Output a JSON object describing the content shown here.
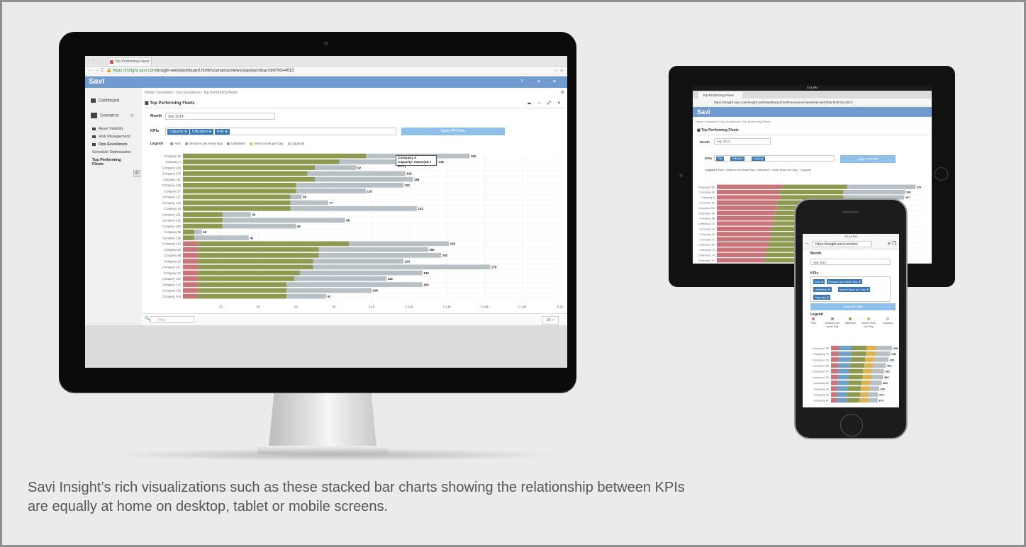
{
  "caption": "Savi Insight’s rich visualizations such as these stacked bar charts showing the relationship between KPIs are equally at home on desktop, tablet or mobile screens.",
  "desktop": {
    "browser": {
      "tab_title": "Top Performing Fleets",
      "url_https": "https://insight.savi.com",
      "url_rest": "/insight-web/dashboard.html#scenarios/views/stacked-hbar.html?id=4013"
    },
    "app": {
      "logo": "Savi",
      "header_icons": "? ⇥ ≡"
    },
    "sidebar": {
      "items": [
        {
          "label": "Dashboard",
          "icon": "dashboard-icon"
        },
        {
          "label": "Scenarios",
          "icon": "bar-chart-icon"
        },
        {
          "label": "Asset Visibility"
        },
        {
          "label": "Risk Management"
        },
        {
          "label": "Ops Excellence"
        },
        {
          "label": "Schedule Optimization"
        },
        {
          "label": "Top Performing Fleets"
        }
      ]
    },
    "breadcrumb": "Home /  Scenarios /  Ops Excellence /  Top Performing Fleets",
    "panel": {
      "title": "Top Performing Fleets",
      "tools": "☁ − ⤢ ×",
      "month_label": "Month",
      "month_value": "Sep 2014",
      "kpis_label": "KPIs",
      "kpi_chips": [
        "Capacity",
        "Utilization",
        "Risk"
      ],
      "apply_label": "Apply KPI Filter",
      "legend_label": "Legend",
      "legend_items": [
        "Risk",
        "Distance per Asset Day",
        "Utilization",
        "Asset Hours per Day",
        "Capacity"
      ],
      "tooltip_title": "Company 4",
      "tooltip_value": "Capacity: 213.6 (46.7 PCT)",
      "filter_placeholder": "Filter",
      "page_size": "25 ÷"
    }
  },
  "tablet": {
    "status_time": "3:31 PM",
    "tab_title": "Top Performing Fleets",
    "url": "https://insight.savi.com/insight-web/dashboard.html#scenarios/views/stacked-hbar.html?id=4013",
    "logo": "Savi",
    "breadcrumb": "Home /  Scenarios /  Ops Excellence /  Top Performing Fleets",
    "title": "Top Performing Fleets",
    "month_label": "Month",
    "month_value": "Sep 2014",
    "kpis_label": "KPIs",
    "kpi_chips": [
      "Risk",
      "Utilization",
      "Capacity"
    ],
    "apply_label": "Apply KPI Filter",
    "legend_label": "Legend",
    "legend_items": [
      "Risk",
      "Distance per Asset Day",
      "Utilization",
      "Asset Hours per Day",
      "Capacity"
    ]
  },
  "phone": {
    "status_time": "12:44 PM",
    "url": "https://insight.savi.com/insi",
    "month_label": "Month",
    "month_value": "Sep 2014",
    "kpis_label": "KPIs",
    "kpi_chips": [
      "Risk",
      "Distance per Asset Day",
      "Utilization",
      "Asset Hours per Day",
      "Capacity"
    ],
    "apply_label": "Apply KPI Filter",
    "legend_label": "Legend",
    "legend_items": [
      "Risk",
      "Distance per Asset Day",
      "Utilization",
      "Asset Hours per Day",
      "Capacity"
    ]
  },
  "colors": {
    "risk": "#c97478",
    "utilization": "#8e9a4f",
    "capacity": "#b7c0c5",
    "distance": "#6fa0c9",
    "asset_hours": "#e0b350",
    "accent": "#6f9bd0",
    "chip": "#3a78b5"
  },
  "chart_data": [
    {
      "type": "bar",
      "orientation": "horizontal",
      "stacked": true,
      "categories": [
        "Company 84",
        "Company 4",
        "Company 149",
        "Company 170",
        "Company 111",
        "Company 148",
        "Company 57",
        "Company 127",
        "Company 124",
        "Company 43",
        "Company 181",
        "Company 131",
        "Company 160",
        "Company 95",
        "Company 136",
        "Company 113",
        "Company 83",
        "Company 88",
        "Company 33",
        "Company 107",
        "Company 54",
        "Company 157",
        "Company 172",
        "Company 116",
        "Company 153"
      ],
      "series": [
        {
          "name": "Risk",
          "values": [
            0,
            0,
            0,
            0,
            0,
            0,
            0,
            0,
            0,
            0,
            0,
            0,
            0,
            0,
            0,
            8,
            8,
            8,
            8,
            8,
            8,
            8,
            8,
            8,
            8
          ]
        },
        {
          "name": "Utilization",
          "values": [
            97,
            83,
            70,
            66,
            70,
            60,
            60,
            57,
            57,
            57,
            21,
            21,
            21,
            6,
            6,
            80,
            64,
            64,
            61,
            61,
            54,
            51,
            47,
            47,
            47
          ]
        },
        {
          "name": "Capacity",
          "values": [
            55,
            52,
            22,
            52,
            52,
            57,
            37,
            6,
            20,
            67,
            15,
            65,
            39,
            4,
            29,
            53,
            58,
            65,
            48,
            94,
            65,
            49,
            72,
            45,
            21
          ]
        }
      ],
      "totals": [
        152,
        135,
        92,
        118,
        169,
        152,
        115,
        58,
        77,
        142,
        36,
        86,
        62,
        18,
        41,
        169,
        150,
        152,
        124,
        176,
        143,
        116,
        150,
        108,
        91
      ],
      "x_ticks": [
        "20",
        "40",
        "60",
        "80",
        "0.1k",
        "0.12k",
        "0.14k",
        "0.16k",
        "0.18k",
        "0.2k"
      ],
      "xlim": [
        0,
        200
      ]
    },
    {
      "type": "bar",
      "orientation": "horizontal",
      "stacked": true,
      "categories": [
        "Company 182",
        "Company 90",
        "Company 8",
        "Company 81",
        "Company 112",
        "Company 150",
        "Company 66",
        "Company 123",
        "Company 14",
        "Company 34",
        "Company 17",
        "Company 130",
        "Company 70",
        "Company 174",
        "Company 141"
      ],
      "series": [
        {
          "name": "Risk",
          "values": [
            120,
            115,
            118,
            110,
            112,
            108,
            105,
            104,
            100,
            100,
            98,
            96,
            92,
            90,
            88
          ]
        },
        {
          "name": "Utilization",
          "values": [
            120,
            118,
            115,
            112,
            108,
            105,
            103,
            100,
            98,
            95,
            92,
            90,
            88,
            85,
            82
          ]
        },
        {
          "name": "Capacity",
          "values": [
            126,
            114,
            112,
            108,
            105,
            102,
            100,
            98,
            95,
            92,
            90,
            88,
            85,
            82,
            80
          ]
        }
      ],
      "totals": [
        376,
        "368",
        "367"
      ]
    },
    {
      "type": "bar",
      "orientation": "horizontal",
      "stacked": true,
      "categories": [
        "Company 182",
        "Company 74",
        "Company 122",
        "Company 160",
        "Company 147",
        "Company 123",
        "Company 86",
        "Company 43",
        "Company 45",
        "Company 87"
      ],
      "series": [
        {
          "name": "Risk",
          "values": [
            60,
            58,
            56,
            54,
            52,
            50,
            48,
            46,
            44,
            42
          ]
        },
        {
          "name": "Distance per Asset Day",
          "values": [
            90,
            90,
            88,
            84,
            80,
            80,
            78,
            76,
            74,
            74
          ]
        },
        {
          "name": "Utilization",
          "values": [
            110,
            108,
            106,
            104,
            102,
            100,
            98,
            96,
            94,
            92
          ]
        },
        {
          "name": "Asset Hours per Day",
          "values": [
            70,
            70,
            68,
            67,
            66,
            65,
            64,
            64,
            64,
            64
          ]
        },
        {
          "name": "Capacity",
          "values": [
            115,
            108,
            102,
            92,
            87,
            85,
            82,
            70,
            68,
            68
          ]
        }
      ],
      "totals": [
        445,
        434,
        420,
        401,
        391,
        380,
        384,
        376,
        372,
        370
      ]
    }
  ]
}
